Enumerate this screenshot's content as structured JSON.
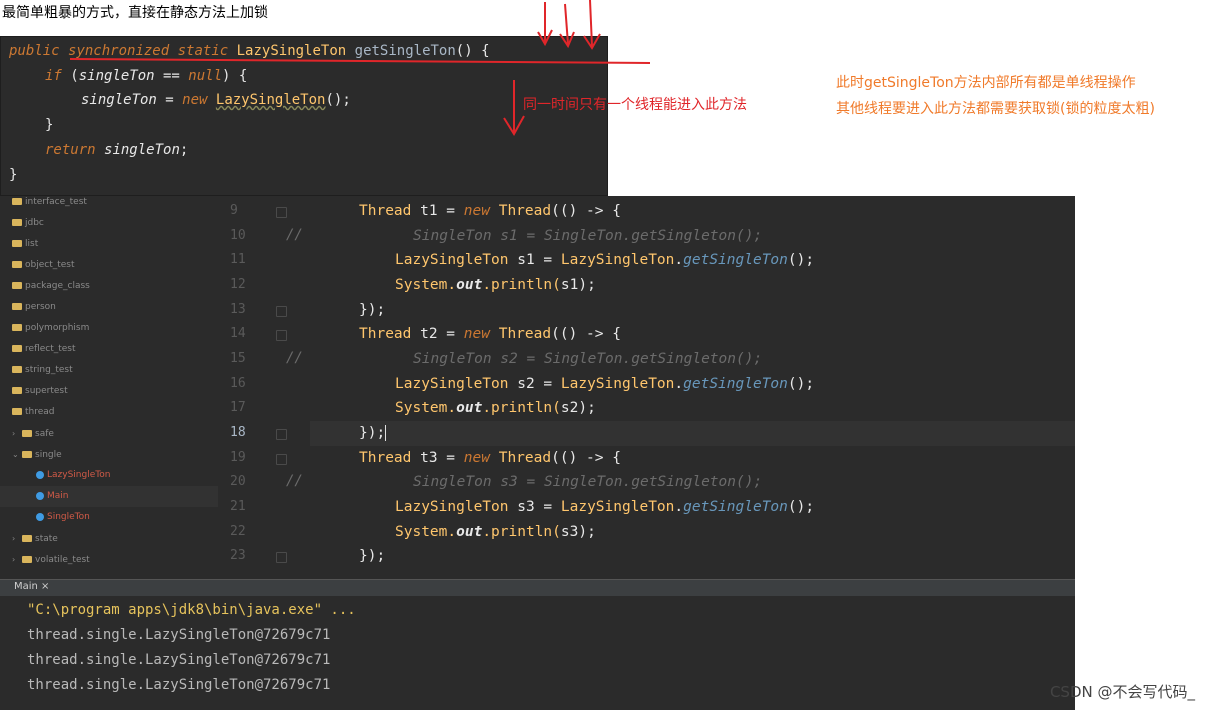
{
  "caption": "最简单粗暴的方式，直接在静态方法上加锁",
  "top_code": {
    "line1": {
      "kw1": "public",
      "kw2": "synchronized",
      "kw3": "static",
      "type": "LazySingleTon",
      "method": "getSingleTon",
      "rest": "() {"
    },
    "line2": {
      "kw": "if",
      "open": " (",
      "var": "singleTon",
      "op": " == ",
      "nul": "null",
      "close": ") {"
    },
    "line3": {
      "var": "singleTon",
      "op": " = ",
      "kw": "new",
      "type": "LazySingleTon",
      "rest": "();"
    },
    "line4": "}",
    "line5": {
      "kw": "return",
      "var": "singleTon",
      "end": ";"
    },
    "line6": "}"
  },
  "annotation_red": "同一时间只有一个线程能进入此方法",
  "annotation_orange": [
    "此时getSingleTon方法内部所有都是单线程操作",
    "其他线程要进入此方法都需要获取锁(锁的粒度太粗)"
  ],
  "tree": [
    {
      "label": "interface_test",
      "kind": "folder",
      "indent": 0
    },
    {
      "label": "jdbc",
      "kind": "folder",
      "indent": 0
    },
    {
      "label": "list",
      "kind": "folder",
      "indent": 0
    },
    {
      "label": "object_test",
      "kind": "folder",
      "indent": 0
    },
    {
      "label": "package_class",
      "kind": "folder",
      "indent": 0
    },
    {
      "label": "person",
      "kind": "folder",
      "indent": 0
    },
    {
      "label": "polymorphism",
      "kind": "folder",
      "indent": 0
    },
    {
      "label": "reflect_test",
      "kind": "folder",
      "indent": 0
    },
    {
      "label": "string_test",
      "kind": "folder",
      "indent": 0
    },
    {
      "label": "supertest",
      "kind": "folder",
      "indent": 0
    },
    {
      "label": "thread",
      "kind": "folder",
      "indent": 0
    },
    {
      "label": "safe",
      "kind": "folder-collapsed",
      "indent": 1
    },
    {
      "label": "single",
      "kind": "folder-expanded",
      "indent": 1
    },
    {
      "label": "LazySingleTon",
      "kind": "class",
      "indent": 2
    },
    {
      "label": "Main",
      "kind": "class",
      "indent": 2
    },
    {
      "label": "SingleTon",
      "kind": "class",
      "indent": 2
    },
    {
      "label": "state",
      "kind": "folder-collapsed",
      "indent": 1
    },
    {
      "label": "volatile_test",
      "kind": "folder-collapsed",
      "indent": 1
    }
  ],
  "line_numbers": [
    "9",
    "10",
    "11",
    "12",
    "13",
    "14",
    "15",
    "16",
    "17",
    "18",
    "19",
    "20",
    "21",
    "22",
    "23"
  ],
  "current_line": "18",
  "code": {
    "thread": "Thread",
    "new": "new",
    "lambda": "(() -> {",
    "comment_prefix": "//",
    "getter_cls": "LazySingleTon",
    "getter": "getSingleTon",
    "sys": "System.",
    "out": "out",
    "println": ".println(",
    "close": "});",
    "t1": " t1 = ",
    "t2": " t2 = ",
    "t3": " t3 = ",
    "c1": "SingleTon s1 = SingleTon.getSingleton();",
    "c2": "SingleTon s2 = SingleTon.getSingleton();",
    "c3": "SingleTon s3 = SingleTon.getSingleton();",
    "a1": " s1 = ",
    "a2": " s2 = ",
    "a3": " s3 = ",
    "p1": "s1",
    "p2": "s2",
    "p3": "s3",
    "call_end": "();",
    "pend": ");"
  },
  "run_tab": "Main ×",
  "console": [
    "\"C:\\program apps\\jdk8\\bin\\java.exe\" ...",
    "thread.single.LazySingleTon@72679c71",
    "thread.single.LazySingleTon@72679c71",
    "thread.single.LazySingleTon@72679c71"
  ],
  "watermark": "CSDN @不会写代码_"
}
